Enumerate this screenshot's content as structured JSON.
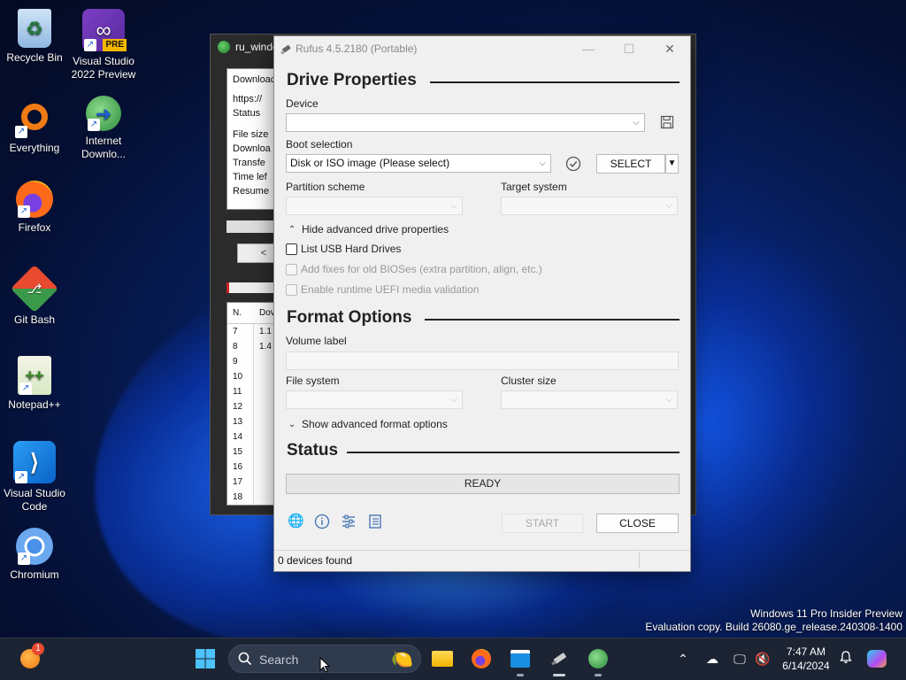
{
  "desktop": {
    "icons": [
      {
        "label": "Recycle Bin"
      },
      {
        "label": "Visual Studio 2022 Preview",
        "badge": "PRE"
      },
      {
        "label": "Everything"
      },
      {
        "label": "Internet Downlo..."
      },
      {
        "label": "Firefox"
      },
      {
        "label": "Git Bash"
      },
      {
        "label": "Notepad++"
      },
      {
        "label": "Visual Studio Code"
      },
      {
        "label": "Chromium"
      }
    ],
    "watermark_line1": "Windows 11 Pro Insider Preview",
    "watermark_line2": "Evaluation copy. Build 26080.ge_release.240308-1400"
  },
  "bg_window": {
    "title": "ru_windo",
    "panel_lines": [
      "Downloac",
      "https://",
      "Status",
      "File size",
      "Downloa",
      "Transfe",
      "Time lef",
      "Resume"
    ],
    "button": "<",
    "grid_header": [
      "N.",
      "Dov"
    ],
    "rows": [
      {
        "n": "7",
        "v": "1.1"
      },
      {
        "n": "8",
        "v": "1.4"
      },
      {
        "n": "9",
        "v": ""
      },
      {
        "n": "10",
        "v": ""
      },
      {
        "n": "11",
        "v": ""
      },
      {
        "n": "12",
        "v": ""
      },
      {
        "n": "13",
        "v": ""
      },
      {
        "n": "14",
        "v": ""
      },
      {
        "n": "15",
        "v": ""
      },
      {
        "n": "16",
        "v": ""
      },
      {
        "n": "17",
        "v": ""
      },
      {
        "n": "18",
        "v": ""
      }
    ]
  },
  "rufus": {
    "title": "Rufus 4.5.2180 (Portable)",
    "drive_properties": "Drive Properties",
    "device_label": "Device",
    "device_value": "",
    "boot_selection_label": "Boot selection",
    "boot_selection_value": "Disk or ISO image (Please select)",
    "select_button": "SELECT",
    "partition_scheme_label": "Partition scheme",
    "target_system_label": "Target system",
    "hide_advanced": "Hide advanced drive properties",
    "list_usb": "List USB Hard Drives",
    "add_fixes": "Add fixes for old BIOSes (extra partition, align, etc.)",
    "enable_uefi": "Enable runtime UEFI media validation",
    "format_options": "Format Options",
    "volume_label_label": "Volume label",
    "file_system_label": "File system",
    "cluster_size_label": "Cluster size",
    "show_advanced_format": "Show advanced format options",
    "status_heading": "Status",
    "status_text": "READY",
    "start_button": "START",
    "close_button": "CLOSE",
    "footer_text": "0 devices found"
  },
  "taskbar": {
    "search_placeholder": "Search",
    "notification_badge": "1",
    "time": "7:47 AM",
    "date": "6/14/2024"
  },
  "colors": {
    "accent": "#3a6fb0",
    "taskbar_bg": "#1c2433"
  }
}
